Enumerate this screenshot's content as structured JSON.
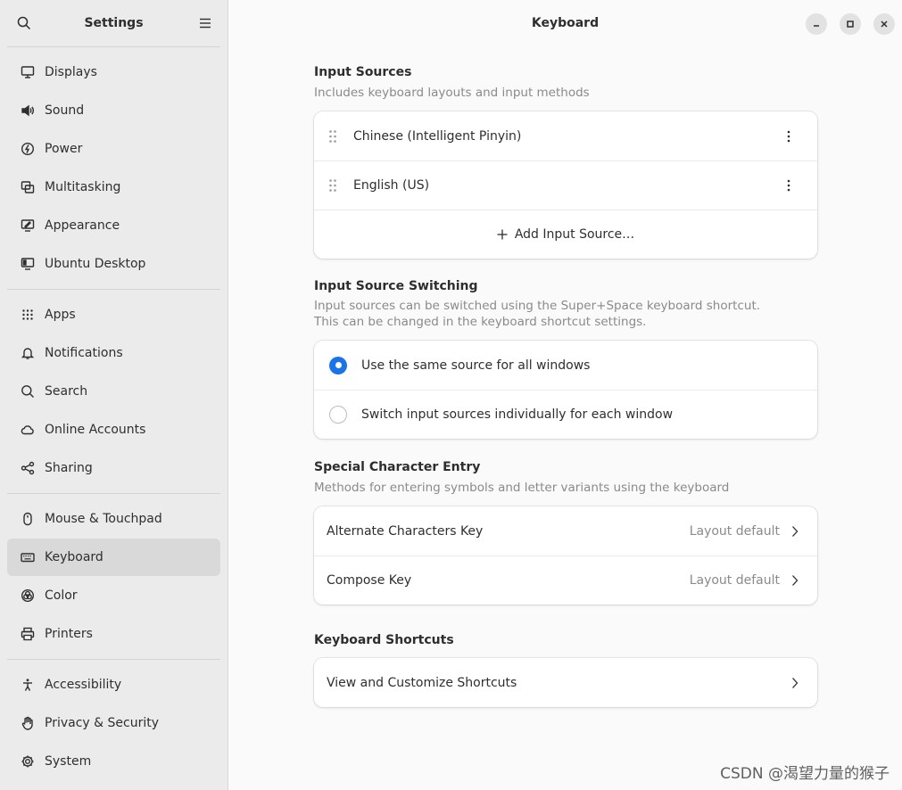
{
  "sidebar": {
    "title": "Settings",
    "groups": [
      [
        {
          "label": "Displays",
          "icon": "display-icon"
        },
        {
          "label": "Sound",
          "icon": "speaker-icon"
        },
        {
          "label": "Power",
          "icon": "power-icon"
        },
        {
          "label": "Multitasking",
          "icon": "multitasking-icon"
        },
        {
          "label": "Appearance",
          "icon": "appearance-icon"
        },
        {
          "label": "Ubuntu Desktop",
          "icon": "desktop-icon"
        }
      ],
      [
        {
          "label": "Apps",
          "icon": "apps-grid-icon"
        },
        {
          "label": "Notifications",
          "icon": "bell-icon"
        },
        {
          "label": "Search",
          "icon": "search-icon"
        },
        {
          "label": "Online Accounts",
          "icon": "cloud-icon"
        },
        {
          "label": "Sharing",
          "icon": "share-icon"
        }
      ],
      [
        {
          "label": "Mouse & Touchpad",
          "icon": "mouse-icon"
        },
        {
          "label": "Keyboard",
          "icon": "keyboard-icon",
          "active": true
        },
        {
          "label": "Color",
          "icon": "color-icon"
        },
        {
          "label": "Printers",
          "icon": "printer-icon"
        }
      ],
      [
        {
          "label": "Accessibility",
          "icon": "accessibility-icon"
        },
        {
          "label": "Privacy & Security",
          "icon": "hand-icon"
        },
        {
          "label": "System",
          "icon": "gear-icon"
        }
      ]
    ]
  },
  "main": {
    "title": "Keyboard",
    "input_sources": {
      "title": "Input Sources",
      "subtitle": "Includes keyboard layouts and input methods",
      "items": [
        "Chinese (Intelligent Pinyin)",
        "English (US)"
      ],
      "add_label": "Add Input Source…"
    },
    "switching": {
      "title": "Input Source Switching",
      "subtitle_line1": "Input sources can be switched using the Super+Space keyboard shortcut.",
      "subtitle_line2": "This can be changed in the keyboard shortcut settings.",
      "option_same": "Use the same source for all windows",
      "option_individual": "Switch input sources individually for each window",
      "selected": "same"
    },
    "special": {
      "title": "Special Character Entry",
      "subtitle": "Methods for entering symbols and letter variants using the keyboard",
      "alternate_label": "Alternate Characters Key",
      "alternate_value": "Layout default",
      "compose_label": "Compose Key",
      "compose_value": "Layout default"
    },
    "shortcuts": {
      "title": "Keyboard Shortcuts",
      "view_label": "View and Customize Shortcuts"
    }
  },
  "watermark": "CSDN @渴望力量的猴子",
  "colors": {
    "accent": "#1a73e8",
    "sidebar_bg": "#ebebeb",
    "active_bg": "#d9d9d9"
  }
}
